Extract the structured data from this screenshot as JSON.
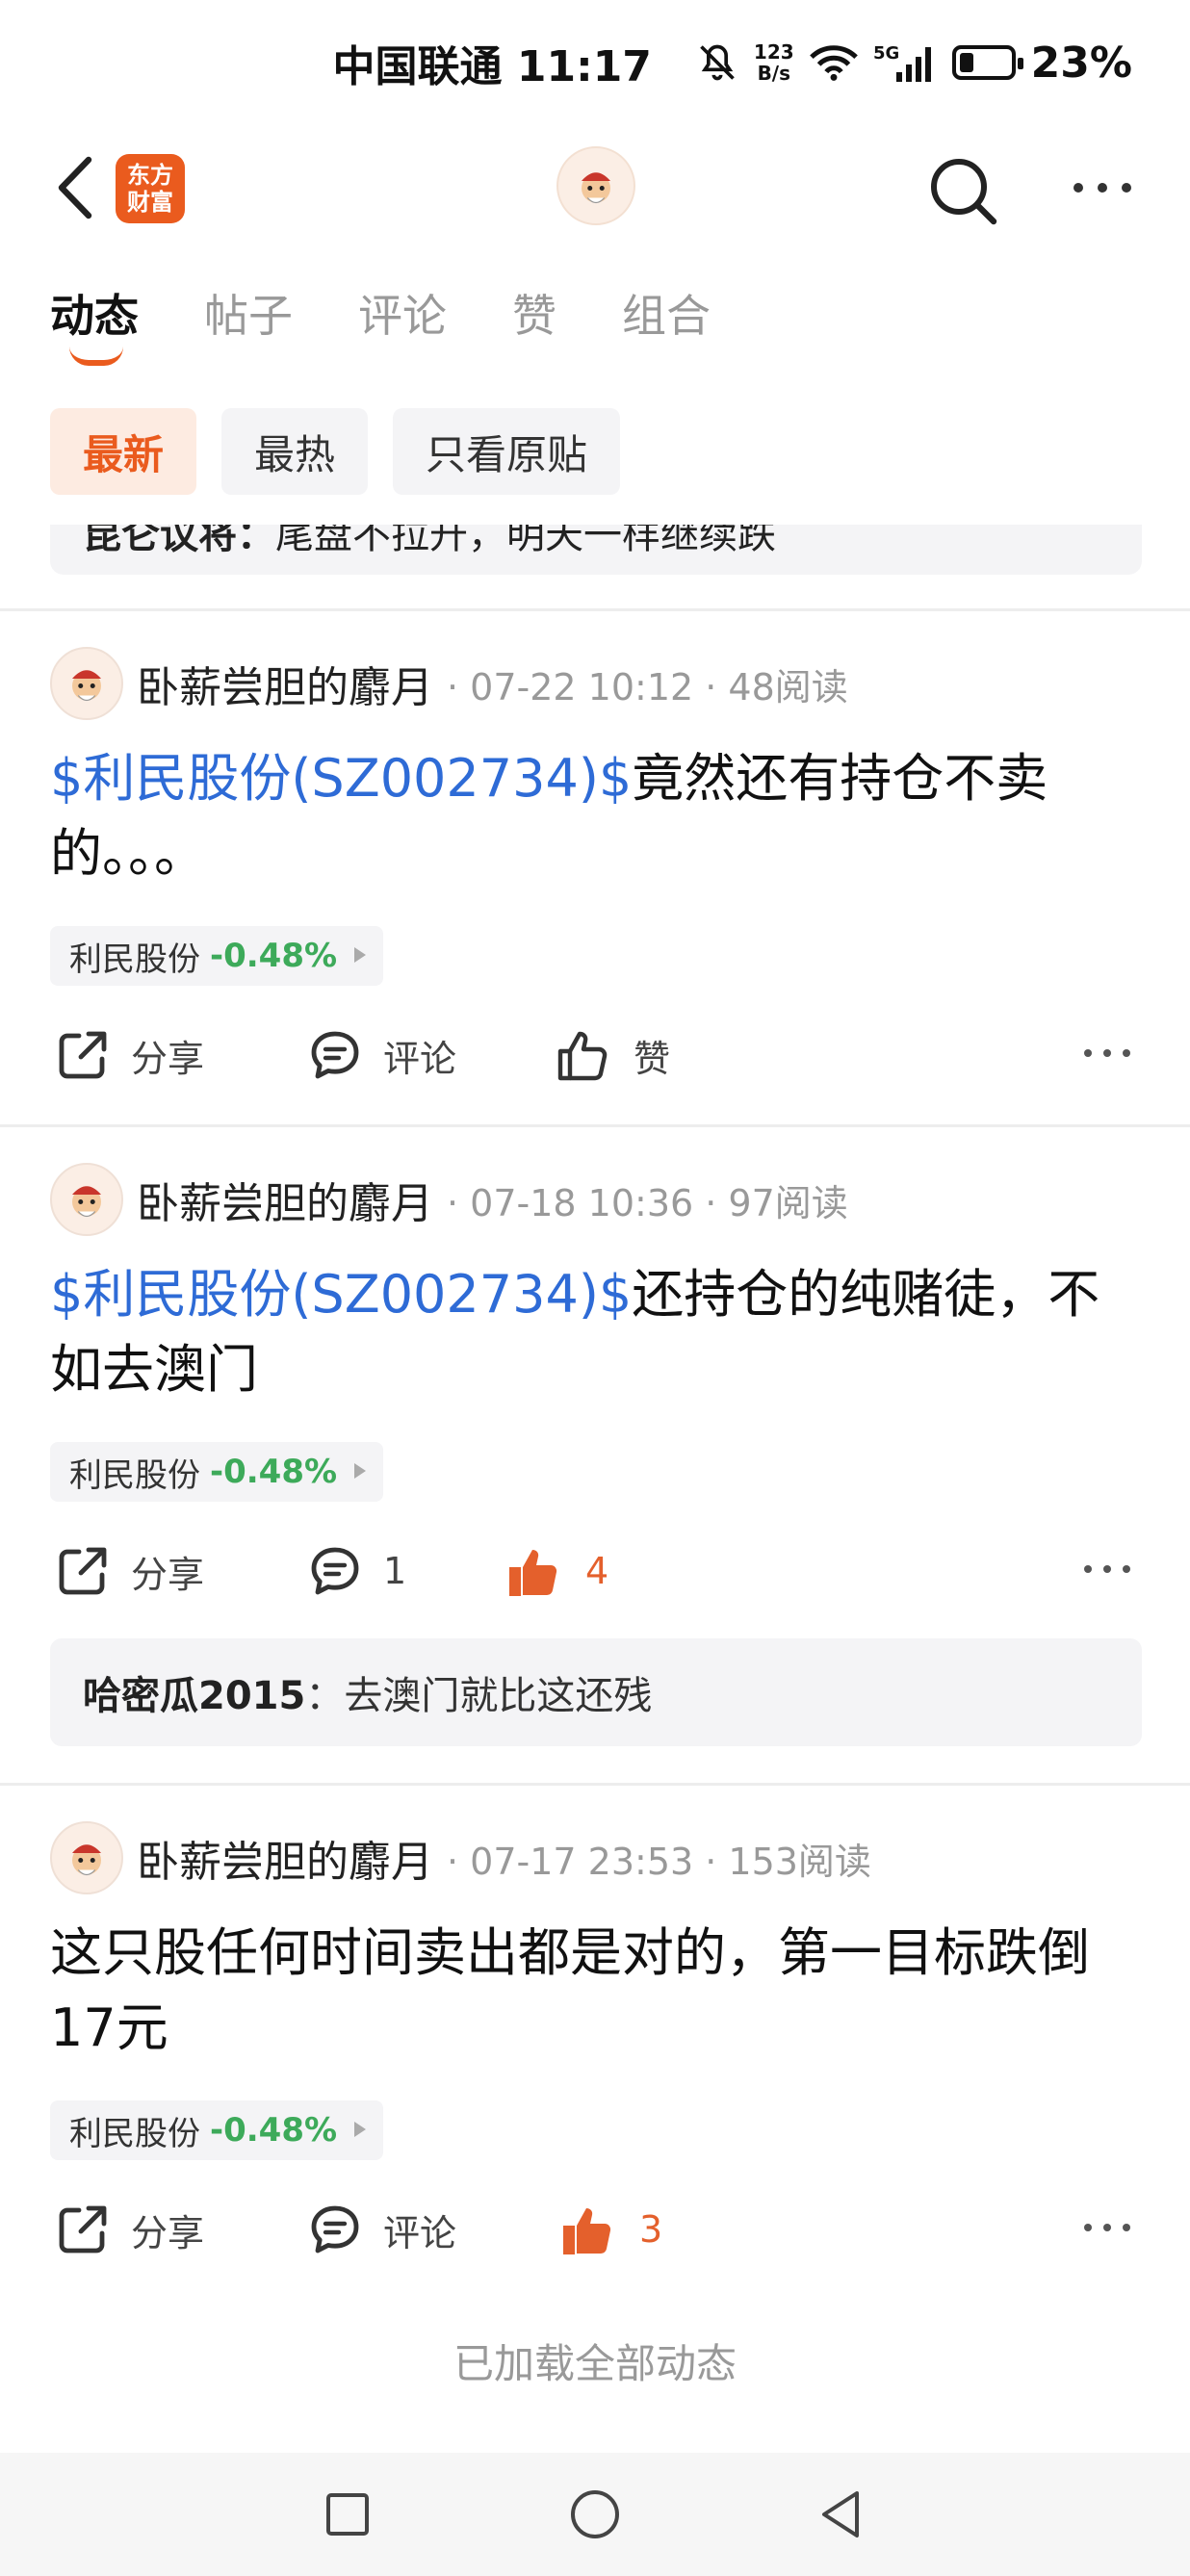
{
  "status_bar": {
    "carrier_time": "中国联通 11:17",
    "net_speed_top": "123",
    "net_speed_bottom": "B/s",
    "battery_pct": "23%",
    "icons": [
      "mute-icon",
      "wifi-icon",
      "signal-5g-icon",
      "battery-icon"
    ]
  },
  "header": {
    "brand_line1": "东方",
    "brand_line2": "财富",
    "icons": [
      "back-icon",
      "search-icon",
      "more-icon"
    ]
  },
  "tabs": [
    {
      "label": "动态",
      "active": true
    },
    {
      "label": "帖子",
      "active": false
    },
    {
      "label": "评论",
      "active": false
    },
    {
      "label": "赞",
      "active": false
    },
    {
      "label": "组合",
      "active": false
    }
  ],
  "filters": [
    {
      "label": "最新",
      "active": true
    },
    {
      "label": "最热",
      "active": false
    },
    {
      "label": "只看原贴",
      "active": false
    }
  ],
  "prev_quote": {
    "name": "昆仑议将：",
    "text": "尾盘不拉升，明天一样继续跌"
  },
  "posts": [
    {
      "author": "卧薪尝胆的麝月",
      "meta": "· 07-22 10:12 · 48阅读",
      "stock_link": "$利民股份(SZ002734)$",
      "text": "竟然还有持仓不卖的。。。",
      "tag_name": "利民股份",
      "tag_change": "-0.48%",
      "share_label": "分享",
      "comment_label": "评论",
      "like_label": "赞",
      "liked": false
    },
    {
      "author": "卧薪尝胆的麝月",
      "meta": "· 07-18 10:36 · 97阅读",
      "stock_link": "$利民股份(SZ002734)$",
      "text": "还持仓的纯赌徒，不如去澳门",
      "tag_name": "利民股份",
      "tag_change": "-0.48%",
      "share_label": "分享",
      "comment_label": "1",
      "like_label": "4",
      "liked": true,
      "reply_name": "哈密瓜2015",
      "reply_sep": "：",
      "reply_text": "去澳门就比这还残"
    },
    {
      "author": "卧薪尝胆的麝月",
      "meta": "· 07-17 23:53 · 153阅读",
      "stock_link": "",
      "text": "这只股任何时间卖出都是对的，第一目标跌倒17元",
      "tag_name": "利民股份",
      "tag_change": "-0.48%",
      "share_label": "分享",
      "comment_label": "评论",
      "like_label": "3",
      "liked": true
    }
  ],
  "footer": {
    "loaded_all": "已加载全部动态"
  },
  "colors": {
    "accent": "#ea5b1e",
    "link": "#2e6bd6",
    "down": "#3daa5a",
    "like": "#e4602c"
  }
}
